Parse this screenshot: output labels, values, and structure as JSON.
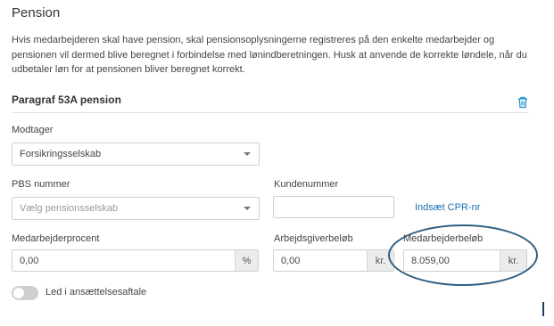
{
  "header": {
    "title": "Pension"
  },
  "description": "Hvis medarbejderen skal have pension, skal pensionsoplysningerne registreres på den enkelte medarbejder og pensionen vil dermed blive beregnet i forbindelse med lønindberetningen. Husk at anvende de korrekte løndele, når du udbetaler løn for at pensionen bliver beregnet korrekt.",
  "section": {
    "title": "Paragraf 53A pension",
    "delete_icon": "trash-icon"
  },
  "fields": {
    "modtager": {
      "label": "Modtager",
      "value": "Forsikringsselskab"
    },
    "pbs": {
      "label": "PBS nummer",
      "placeholder": "Vælg pensionsselskab"
    },
    "kundenummer": {
      "label": "Kundenummer",
      "value": ""
    },
    "cpr_link": "Indsæt CPR-nr",
    "medarbejderprocent": {
      "label": "Medarbejderprocent",
      "value": "0,00",
      "suffix": "%"
    },
    "arbejdsgiverbelob": {
      "label": "Arbejdsgiverbeløb",
      "value": "0,00",
      "suffix": "kr."
    },
    "medarbejderbelob": {
      "label": "Medarbejderbeløb",
      "value": "8.059,00",
      "suffix": "kr."
    }
  },
  "toggle": {
    "label": "Led i ansættelsesaftale",
    "on": false
  },
  "colors": {
    "link": "#1a6fb0",
    "highlight": "#2e5d80",
    "toggle_off": "#cfcfcf"
  }
}
